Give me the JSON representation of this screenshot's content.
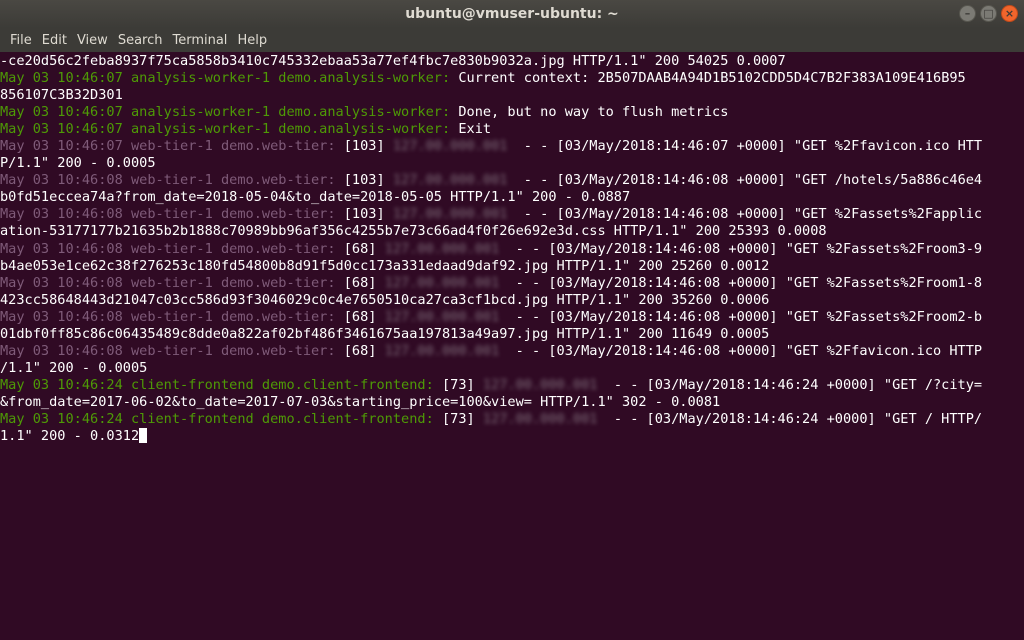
{
  "window": {
    "title": "ubuntu@vmuser-ubuntu: ~",
    "minimize_glyph": "–",
    "maximize_glyph": "□",
    "close_glyph": "×"
  },
  "menu": [
    "File",
    "Edit",
    "View",
    "Search",
    "Terminal",
    "Help"
  ],
  "terminal": {
    "l00": "-ce20d56c2feba8937f75ca5858b3410c745332ebaa53a77ef4fbc7e830b9032a.jpg HTTP/1.1\" 200 54025 0.0007",
    "l01_prefix": "May 03 10:46:07 analysis-worker-1 demo.analysis-worker:",
    "l01_msg": " Current context: 2B507DAAB4A94D1B5102CDD5D4C7B2F383A109E416B95",
    "l02": "856107C3B32D301",
    "l03_prefix": "May 03 10:46:07 analysis-worker-1 demo.analysis-worker:",
    "l03_msg": " Done, but no way to flush metrics",
    "l04_prefix": "May 03 10:46:07 analysis-worker-1 demo.analysis-worker:",
    "l04_msg": " Exit",
    "l05_prefix": "May 03 10:46:07 web-tier-1 demo.web-tier:",
    "l05_pid": " [103] ",
    "l05_ip": "127.00.000.001",
    "l05_msg": "  - - [03/May/2018:14:46:07 +0000] \"GET %2Ffavicon.ico HTT",
    "l06": "P/1.1\" 200 - 0.0005",
    "l07_prefix": "May 03 10:46:08 web-tier-1 demo.web-tier:",
    "l07_pid": " [103] ",
    "l07_ip": "127.00.000.001",
    "l07_msg": "  - - [03/May/2018:14:46:08 +0000] \"GET /hotels/5a886c46e4",
    "l08": "b0fd51eccea74a?from_date=2018-05-04&to_date=2018-05-05 HTTP/1.1\" 200 - 0.0887",
    "l09_prefix": "May 03 10:46:08 web-tier-1 demo.web-tier:",
    "l09_pid": " [103] ",
    "l09_ip": "127.00.000.001",
    "l09_msg": "  - - [03/May/2018:14:46:08 +0000] \"GET %2Fassets%2Fapplic",
    "l10": "ation-53177177b21635b2b1888c70989bb96af356c4255b7e73c66ad4f0f26e692e3d.css HTTP/1.1\" 200 25393 0.0008",
    "l11_prefix": "May 03 10:46:08 web-tier-1 demo.web-tier:",
    "l11_pid": " [68] ",
    "l11_ip": "127.00.000.001",
    "l11_msg": "  - - [03/May/2018:14:46:08 +0000] \"GET %2Fassets%2Froom3-9",
    "l12": "b4ae053e1ce62c38f276253c180fd54800b8d91f5d0cc173a331edaad9daf92.jpg HTTP/1.1\" 200 25260 0.0012",
    "l13_prefix": "May 03 10:46:08 web-tier-1 demo.web-tier:",
    "l13_pid": " [68] ",
    "l13_ip": "127.00.000.001",
    "l13_msg": "  - - [03/May/2018:14:46:08 +0000] \"GET %2Fassets%2Froom1-8",
    "l14": "423cc58648443d21047c03cc586d93f3046029c0c4e7650510ca27ca3cf1bcd.jpg HTTP/1.1\" 200 35260 0.0006",
    "l15_prefix": "May 03 10:46:08 web-tier-1 demo.web-tier:",
    "l15_pid": " [68] ",
    "l15_ip": "127.00.000.001",
    "l15_msg": "  - - [03/May/2018:14:46:08 +0000] \"GET %2Fassets%2Froom2-b",
    "l16": "01dbf0ff85c86c06435489c8dde0a822af02bf486f3461675aa197813a49a97.jpg HTTP/1.1\" 200 11649 0.0005",
    "l17_prefix": "May 03 10:46:08 web-tier-1 demo.web-tier:",
    "l17_pid": " [68] ",
    "l17_ip": "127.00.000.001",
    "l17_msg": "  - - [03/May/2018:14:46:08 +0000] \"GET %2Ffavicon.ico HTTP",
    "l18": "/1.1\" 200 - 0.0005",
    "l19_prefix": "May 03 10:46:24 client-frontend demo.client-frontend:",
    "l19_pid": " [73] ",
    "l19_ip": "127.00.000.001",
    "l19_msg": "  - - [03/May/2018:14:46:24 +0000] \"GET /?city=",
    "l20": "&from_date=2017-06-02&to_date=2017-07-03&starting_price=100&view= HTTP/1.1\" 302 - 0.0081",
    "l21_prefix": "May 03 10:46:24 client-frontend demo.client-frontend:",
    "l21_pid": " [73] ",
    "l21_ip": "127.00.000.001",
    "l21_msg": "  - - [03/May/2018:14:46:24 +0000] \"GET / HTTP/",
    "l22": "1.1\" 200 - 0.0312"
  },
  "colors": {
    "background": "#300a24",
    "green": "#4e9a06",
    "dim": "#7f5b79",
    "text": "#ffffff"
  }
}
